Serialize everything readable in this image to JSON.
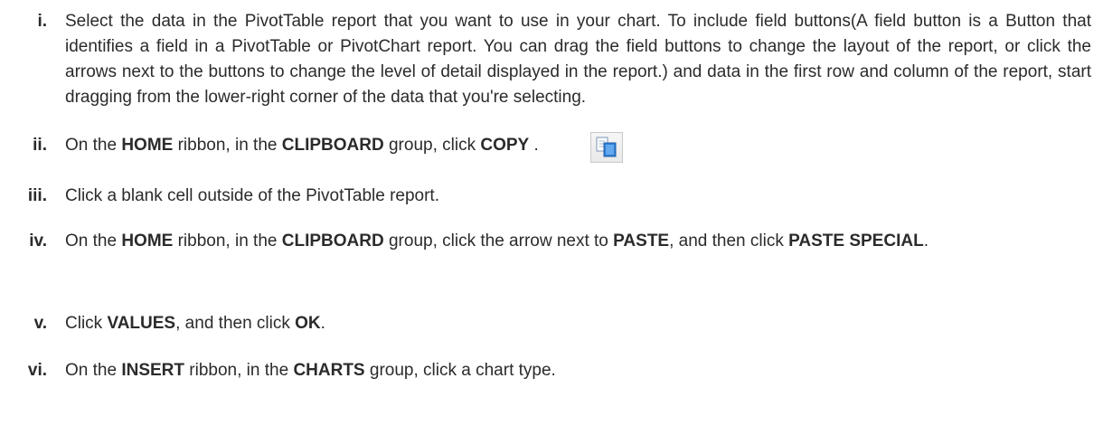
{
  "steps": [
    {
      "num": "i.",
      "parts": [
        {
          "t": "Select the data in the PivotTable report that you want to use in your chart. To include field buttons(A field button is a Button that identifies a field in a PivotTable or PivotChart report. You can drag the field buttons to change the layout of the report, or click the arrows next to the buttons to change the level of detail displayed in the report.) and data in the first row and column of the report, start dragging from the lower-right corner of the data that you're selecting."
        }
      ]
    },
    {
      "num": "ii.",
      "parts": [
        {
          "t": "On the "
        },
        {
          "t": "HOME",
          "b": true
        },
        {
          "t": " ribbon, in the "
        },
        {
          "t": "CLIPBOARD",
          "b": true
        },
        {
          "t": " group, click "
        },
        {
          "t": "COPY",
          "b": true
        },
        {
          "t": " ."
        }
      ],
      "icon": "copy-icon"
    },
    {
      "num": "iii.",
      "parts": [
        {
          "t": "Click a blank cell outside of the PivotTable report."
        }
      ]
    },
    {
      "num": "iv.",
      "parts": [
        {
          "t": "On the "
        },
        {
          "t": "HOME",
          "b": true
        },
        {
          "t": " ribbon, in the "
        },
        {
          "t": "CLIPBOARD",
          "b": true
        },
        {
          "t": " group, click the arrow next to "
        },
        {
          "t": "PASTE",
          "b": true
        },
        {
          "t": ", and then click "
        },
        {
          "t": "PASTE SPECIAL",
          "b": true
        },
        {
          "t": "."
        }
      ]
    },
    {
      "num": "v.",
      "parts": [
        {
          "t": "Click "
        },
        {
          "t": "VALUES",
          "b": true
        },
        {
          "t": ", and then click "
        },
        {
          "t": "OK",
          "b": true
        },
        {
          "t": "."
        }
      ]
    },
    {
      "num": "vi.",
      "parts": [
        {
          "t": "On the "
        },
        {
          "t": "INSERT",
          "b": true
        },
        {
          "t": " ribbon, in the "
        },
        {
          "t": "CHARTS",
          "b": true
        },
        {
          "t": " group, click a chart type."
        }
      ]
    }
  ]
}
